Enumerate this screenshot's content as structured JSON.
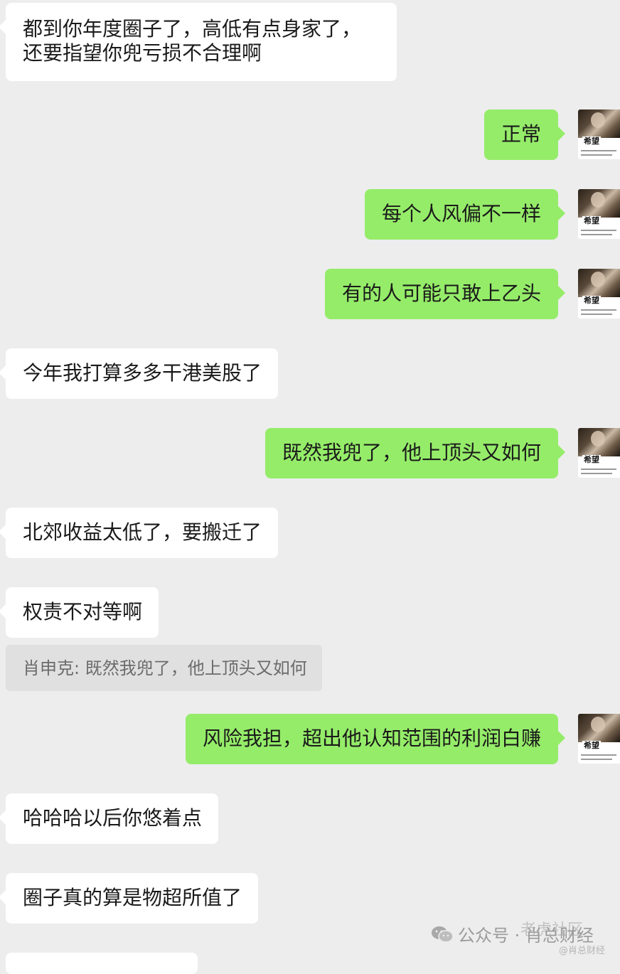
{
  "messages": [
    {
      "side": "left",
      "text": "都到你年度圈子了，高低有点身家了，还要指望你兜亏损不合理啊"
    },
    {
      "side": "right",
      "text": "正常"
    },
    {
      "side": "right",
      "text": "每个人风偏不一样"
    },
    {
      "side": "right",
      "text": "有的人可能只敢上乙头"
    },
    {
      "side": "left",
      "text": "今年我打算多多干港美股了"
    },
    {
      "side": "right",
      "text": "既然我兜了，他上顶头又如何"
    },
    {
      "side": "left",
      "text": "北郊收益太低了，要搬迁了"
    },
    {
      "side": "left",
      "text": "权责不对等啊"
    },
    {
      "side": "left",
      "text": "风险我担，超出他认知范围的利润白赚"
    },
    {
      "side": "left",
      "text": "哈哈哈以后你悠着点"
    },
    {
      "side": "left",
      "text": "圈子真的算是物超所值了"
    }
  ],
  "quote": {
    "text": "肖申克: 既然我兜了，他上顶头又如何"
  },
  "avatar": {
    "label": "希望"
  },
  "watermark": {
    "icon": "wechat-icon",
    "account": "公众号 · 肖总财经",
    "site_mark": "老虎社区",
    "site_sub": "@肖总财经"
  },
  "colors": {
    "background": "#ededed",
    "incoming_bubble": "#ffffff",
    "outgoing_bubble": "#95ec69",
    "quote_bg": "#e0e0e0"
  }
}
